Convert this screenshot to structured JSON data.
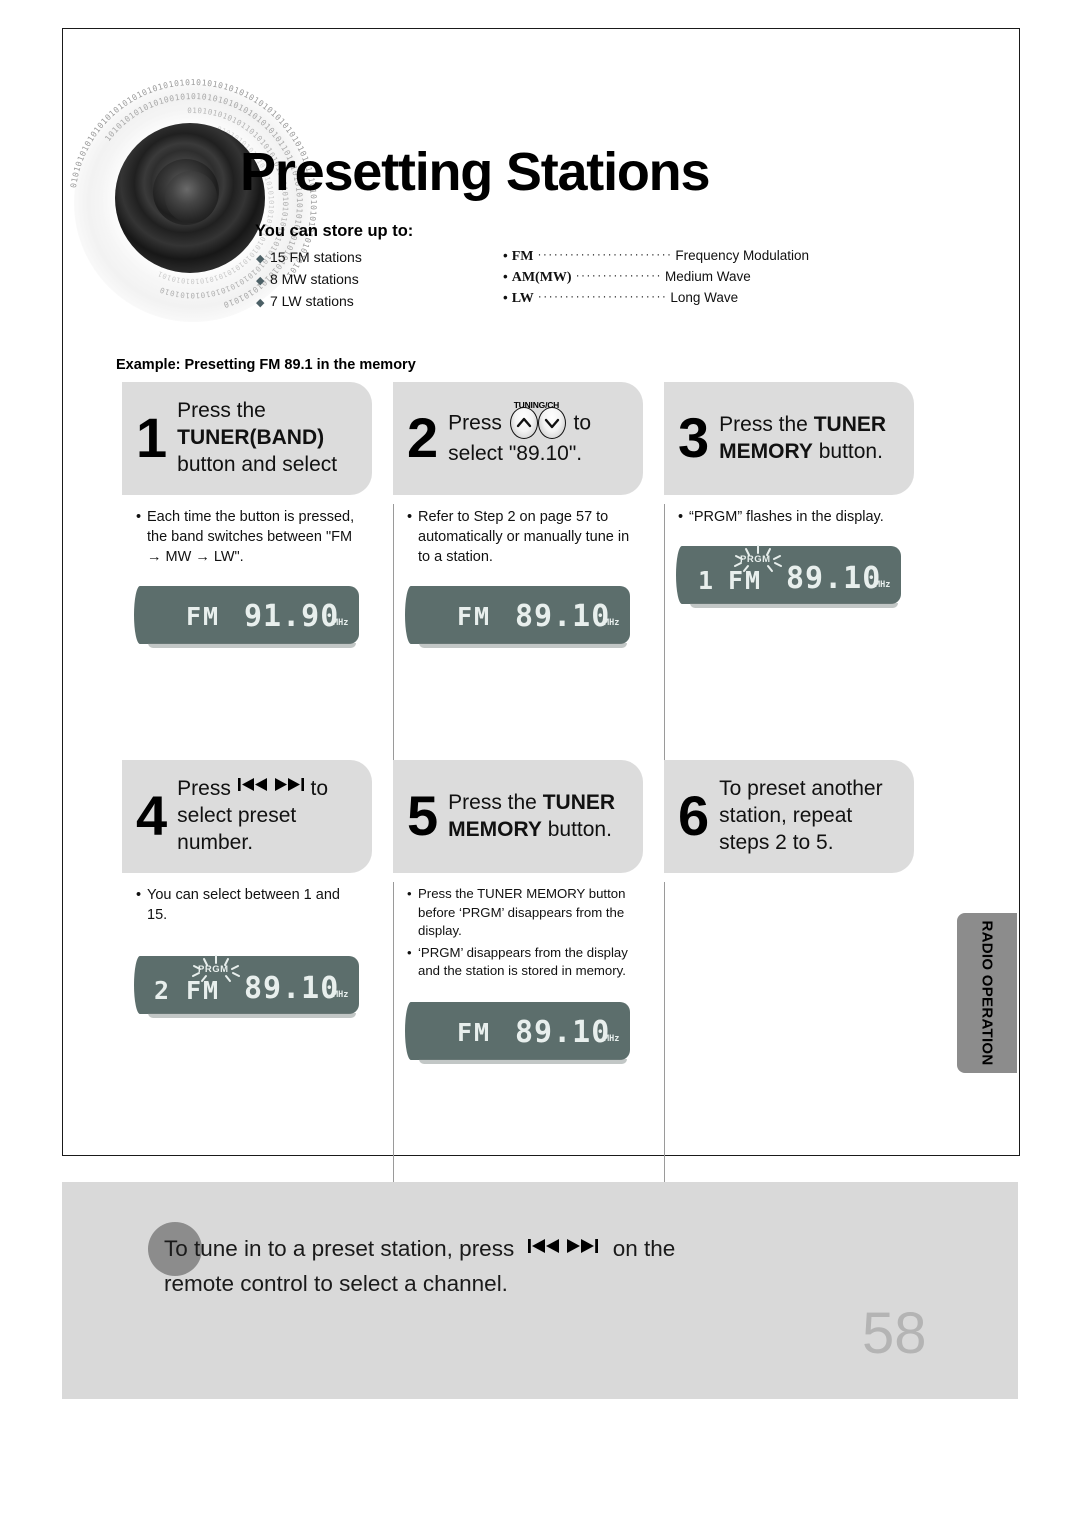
{
  "header": {
    "title": "Presetting Stations",
    "store_heading": "You can store up to:",
    "store_items": [
      "15 FM stations",
      "8 MW stations",
      "7 LW stations"
    ],
    "abbreviations": [
      {
        "key": "FM",
        "value": "Frequency Modulation",
        "leader": "·························"
      },
      {
        "key": "AM(MW)",
        "value": "Medium Wave",
        "leader": "················"
      },
      {
        "key": "LW",
        "value": "Long Wave",
        "leader": "························"
      }
    ]
  },
  "example_label": "Example: Presetting FM 89.1 in the memory",
  "steps": [
    {
      "number": "1",
      "text_line1": "Press the",
      "text_bold": "TUNER(BAND)",
      "text_line3": "button  and select",
      "notes": [
        "Each time the button is pressed, the band switches between \"FM → MW  → LW\"."
      ],
      "display": {
        "preset": "",
        "band": "FM",
        "freq": "91.90",
        "unit": "MHz",
        "prgm": "",
        "prgm_flashing": false
      }
    },
    {
      "number": "2",
      "text_before": "Press",
      "text_after": "to",
      "text_line2": "select \"89.10\".",
      "icon_label": "TUNING/CH",
      "notes": [
        "Refer to Step 2 on page 57 to automatically or manually tune in to a station."
      ],
      "display": {
        "preset": "",
        "band": "FM",
        "freq": "89.10",
        "unit": "MHz",
        "prgm": "",
        "prgm_flashing": false
      }
    },
    {
      "number": "3",
      "text_plain1": "Press the ",
      "text_bold1": "TUNER",
      "text_bold2": "MEMORY",
      "text_plain2": " button.",
      "notes": [
        "“PRGM” flashes in the display."
      ],
      "display": {
        "preset": "1",
        "band": "FM",
        "freq": "89.10",
        "unit": "MHz",
        "prgm": "PRGM",
        "prgm_flashing": true
      }
    },
    {
      "number": "4",
      "text_before": "Press",
      "text_after": "to",
      "text_line2": "select preset",
      "text_line3": "number.",
      "notes": [
        "You can select between 1 and 15."
      ],
      "display": {
        "preset": "2",
        "band": "FM",
        "freq": "89.10",
        "unit": "MHz",
        "prgm": "PRGM",
        "prgm_flashing": true
      }
    },
    {
      "number": "5",
      "text_plain1": "Press the ",
      "text_bold1": "TUNER",
      "text_bold2": "MEMORY",
      "text_plain2": " button.",
      "notes": [
        "Press the TUNER MEMORY button before ‘PRGM’ disappears from the display.",
        "‘PRGM’ disappears from the display and the station is stored in memory."
      ],
      "note_bold_prefix": "TUNER MEMORY",
      "display": {
        "preset": "",
        "band": "FM",
        "freq": "89.10",
        "unit": "MHz",
        "prgm": "",
        "prgm_flashing": false
      }
    },
    {
      "number": "6",
      "text_line1": "To preset another",
      "text_line2": "station, repeat",
      "text_line3": "steps 2 to 5.",
      "notes": [],
      "display": null
    }
  ],
  "side_tab": {
    "label": "RADIO OPERATION"
  },
  "footer": {
    "text_part1": "To tune in to a preset station, press",
    "text_part2": "on the",
    "text_line2": "remote control to select a channel.",
    "page_number": "58"
  },
  "icons": {
    "tuning_up": "chevron-up-icon",
    "tuning_down": "chevron-down-icon",
    "skip_back": "skip-back-icon",
    "skip_forward": "skip-forward-icon"
  },
  "colors": {
    "step_box": "#dcdcdc",
    "lcd_bg": "#5c6e6c",
    "lcd_text": "#e8efed",
    "side_tab": "#8c8c8c",
    "footer_band": "#d9d9d9",
    "page_number": "#b4b4b4"
  }
}
